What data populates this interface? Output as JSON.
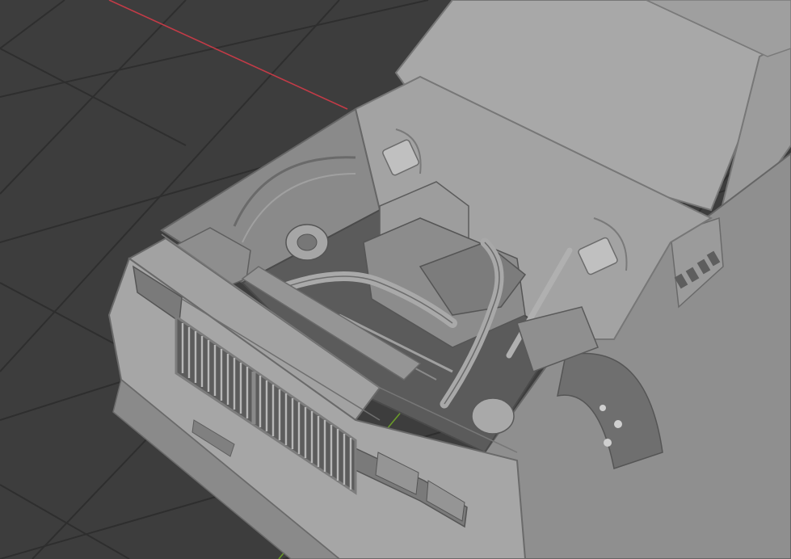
{
  "app": {
    "type": "3d-viewport"
  },
  "viewport": {
    "subject": "car-model-open-hood",
    "colors": {
      "background": "#3d3d3d",
      "grid_line": "#2f2f2f",
      "axis_x": "#c23b47",
      "axis_y": "#6a9a2a",
      "model_base": "#9a9a9a",
      "model_light": "#b2b2b2",
      "model_dark": "#6e6e6e",
      "model_shadow": "#555555"
    }
  }
}
